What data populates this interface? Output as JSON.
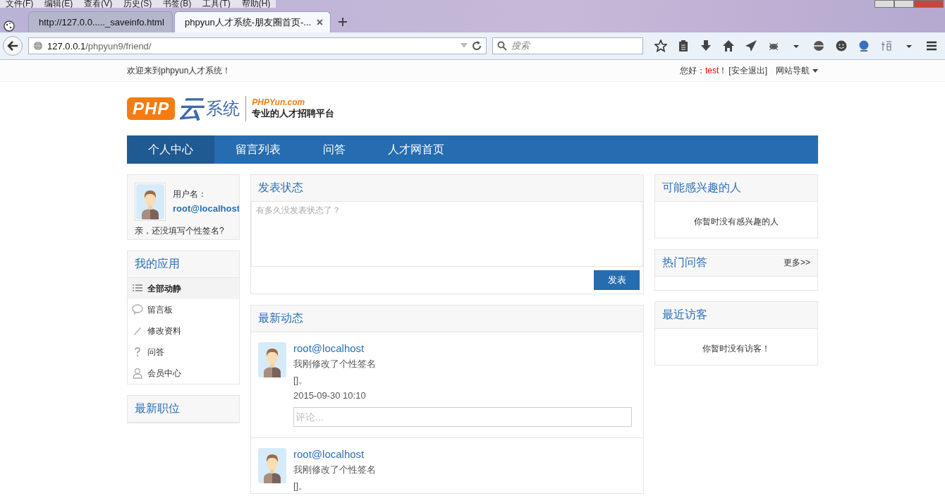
{
  "browser": {
    "menu": [
      "文件(F)",
      "编辑(E)",
      "查看(V)",
      "历史(S)",
      "书签(B)",
      "工具(T)",
      "帮助(H)"
    ],
    "tabs": [
      {
        "title": "http://127.0.0....._saveinfo.html",
        "selected": false
      },
      {
        "title": "phpyun人才系统-朋友圈首页-...",
        "selected": true
      }
    ],
    "address": {
      "host": "127.0.0.1",
      "path": "/phpyun9/friend/"
    },
    "search": {
      "placeholder": "搜索"
    }
  },
  "top_bar": {
    "welcome": "欢迎来到phpyun人才系统！",
    "greeting": "您好：",
    "username": "test",
    "exclaim": "！",
    "logout": "[安全退出]",
    "site_nav": "网站导航"
  },
  "logo": {
    "mark": "PHP",
    "cloud": "云",
    "system": "系统",
    "domain": "PHPYun.com",
    "slogan": "专业的人才招聘平台"
  },
  "nav": [
    {
      "label": "个人中心",
      "selected": true
    },
    {
      "label": "留言列表",
      "selected": false
    },
    {
      "label": "问答",
      "selected": false
    },
    {
      "label": "人才网首页",
      "selected": false
    }
  ],
  "profile": {
    "label": "用户名：",
    "username": "root@localhost",
    "signature": "亲，还没填写个性签名?"
  },
  "apps": {
    "title": "我的应用",
    "items": [
      {
        "label": "全部动静",
        "kind": "list",
        "selected": true
      },
      {
        "label": "留言板",
        "kind": "bubble",
        "selected": false
      },
      {
        "label": "修改资料",
        "kind": "pencil",
        "selected": false
      },
      {
        "label": "问答",
        "kind": "question",
        "selected": false
      },
      {
        "label": "会员中心",
        "kind": "person",
        "selected": false
      }
    ]
  },
  "jobs": {
    "title": "最新职位"
  },
  "post": {
    "title": "发表状态",
    "placeholder": "有多久没发表状态了？",
    "button": "发表"
  },
  "feed": {
    "title": "最新动态",
    "items": [
      {
        "user": "root@localhost",
        "text": "我刚修改了个性签名",
        "extra": "[]。",
        "time": "2015-09-30 10:10",
        "comment_placeholder": "评论..."
      },
      {
        "user": "root@localhost",
        "text": "我刚修改了个性签名",
        "extra": "[]。"
      }
    ]
  },
  "interest": {
    "title": "可能感兴趣的人",
    "empty": "你暂时没有感兴趣的人"
  },
  "hot_qa": {
    "title": "热门问答",
    "more": "更多>>"
  },
  "visitors": {
    "title": "最近访客",
    "empty": "你暂时没有访客！"
  }
}
